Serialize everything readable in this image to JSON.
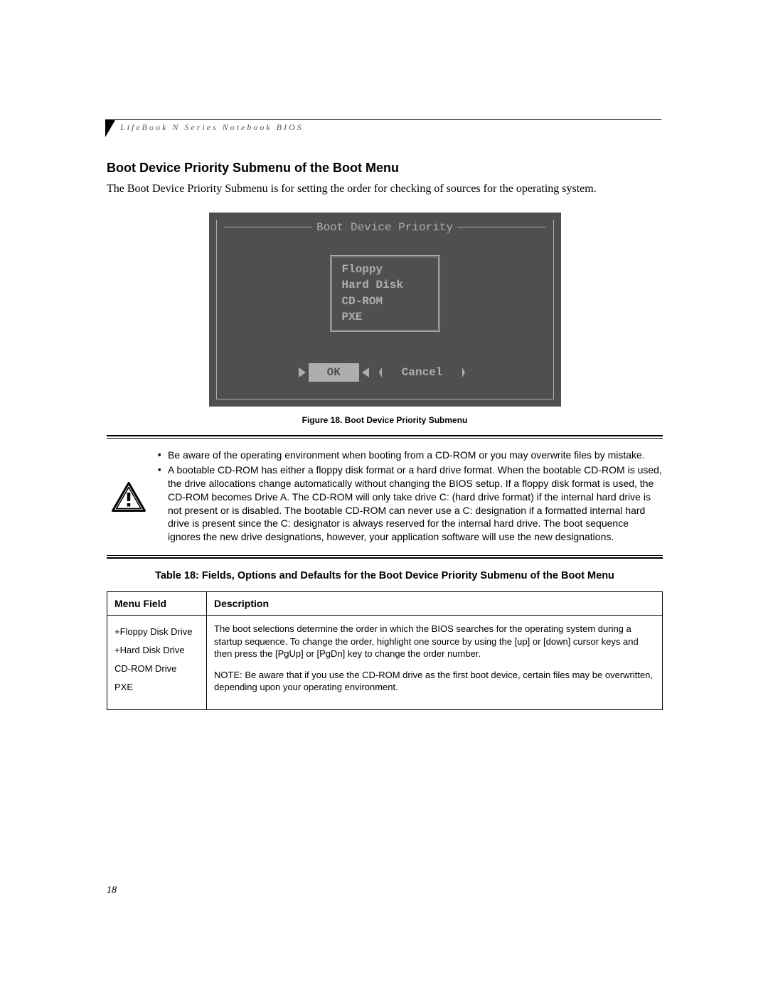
{
  "running_head": "LifeBook N Series Notebook BIOS",
  "section_title": "Boot Device Priority Submenu of the Boot Menu",
  "section_desc": "The Boot Device Priority Submenu is for setting the order for checking of sources for the operating system.",
  "bios": {
    "title": "Boot Device Priority",
    "items": [
      "Floppy",
      "Hard Disk",
      "CD-ROM",
      "PXE"
    ],
    "ok": "OK",
    "cancel": "Cancel"
  },
  "figure_caption": "Figure 18.  Boot Device Priority Submenu",
  "warning": {
    "bullets": [
      "Be aware of the operating environment when booting from a CD-ROM or you may overwrite files by mistake.",
      "A bootable CD-ROM has either a floppy disk format or a hard drive format. When the bootable CD-ROM is used, the drive allocations change automatically without changing the BIOS setup. If a floppy disk format is used, the CD-ROM becomes Drive A. The CD-ROM will only take drive C: (hard drive format) if the internal hard drive is not present or is disabled. The bootable CD-ROM can never use a C: designation if a formatted internal hard drive is present since the C: designator is always reserved for the internal hard drive. The boot sequence ignores the new drive designations, however, your application software will use the new designations."
    ]
  },
  "table_caption": "Table 18: Fields, Options and Defaults for the Boot Device Priority Submenu of the Boot Menu",
  "table": {
    "header": {
      "col1": "Menu Field",
      "col2": "Description"
    },
    "menu_fields": [
      "+Floppy Disk Drive",
      "+Hard Disk Drive",
      " CD-ROM Drive",
      " PXE"
    ],
    "description_p1": "The boot selections determine the order in which the BIOS searches for the operating system during a startup sequence. To change the order, highlight one source by using the [up] or [down] cursor keys and then press the [PgUp] or [PgDn] key to change the order number.",
    "description_p2": "NOTE: Be aware that if you use the CD-ROM drive as the first boot device, certain files may be overwritten, depending upon your operating environment."
  },
  "page_number": "18"
}
